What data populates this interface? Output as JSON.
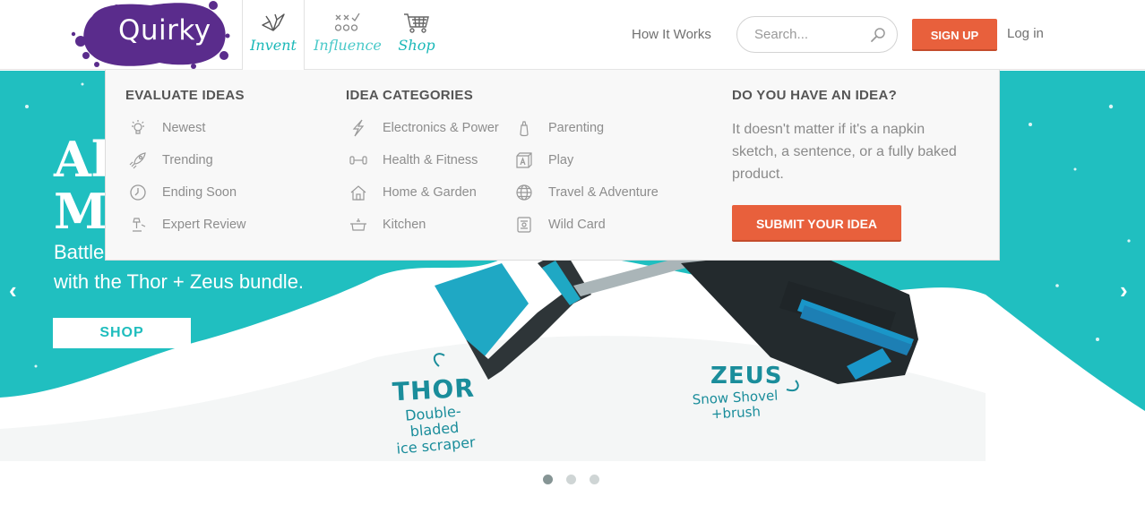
{
  "brand": {
    "logo_text": "Quirky",
    "logo_color": "#5a2c8c"
  },
  "nav": {
    "tabs": [
      {
        "label": "Invent",
        "icon": "paper-crane-icon",
        "active": true
      },
      {
        "label": "Influence",
        "icon": "tic-tac-toe-icon",
        "active": false
      },
      {
        "label": "Shop",
        "icon": "shopping-cart-icon",
        "active": false
      }
    ],
    "how_it_works": "How It Works",
    "search_placeholder": "Search...",
    "signup": "SIGN UP",
    "login": "Log in"
  },
  "menu": {
    "evaluate": {
      "title": "EVALUATE IDEAS",
      "items": [
        {
          "label": "Newest",
          "icon": "lightbulb-icon"
        },
        {
          "label": "Trending",
          "icon": "rocket-icon"
        },
        {
          "label": "Ending Soon",
          "icon": "clock-icon"
        },
        {
          "label": "Expert Review",
          "icon": "expert-lamp-icon"
        }
      ]
    },
    "categories": {
      "title": "IDEA CATEGORIES",
      "items": [
        {
          "label": "Electronics & Power",
          "icon": "lightning-icon"
        },
        {
          "label": "Health & Fitness",
          "icon": "dumbbell-icon"
        },
        {
          "label": "Home & Garden",
          "icon": "house-icon"
        },
        {
          "label": "Kitchen",
          "icon": "pot-icon"
        },
        {
          "label": "Parenting",
          "icon": "baby-bottle-icon"
        },
        {
          "label": "Play",
          "icon": "letter-block-icon"
        },
        {
          "label": "Travel & Adventure",
          "icon": "globe-icon"
        },
        {
          "label": "Wild Card",
          "icon": "wild-card-icon"
        }
      ]
    },
    "pitch": {
      "title": "DO YOU HAVE AN IDEA?",
      "text": "It doesn't matter if it's a napkin sketch, a sentence, or a fully baked product.",
      "button": "SUBMIT YOUR IDEA"
    }
  },
  "hero": {
    "title_line1": "Al",
    "title_line2": "M",
    "subtitle_line1": "Battle",
    "subtitle_line2": "with the Thor + Zeus bundle.",
    "shop": "SHOP",
    "thor_name": "THOR",
    "thor_desc_line1": "Double-bladed",
    "thor_desc_line2": "ice scraper",
    "zeus_name": "ZEUS",
    "zeus_desc_line1": "Snow Shovel",
    "zeus_desc_line2": "+brush",
    "background_color": "#20bfc0",
    "carousel": {
      "slides": 3,
      "active_slide": 1
    }
  },
  "colors": {
    "accent": "#e8603c",
    "teal": "#1ab8b8"
  }
}
